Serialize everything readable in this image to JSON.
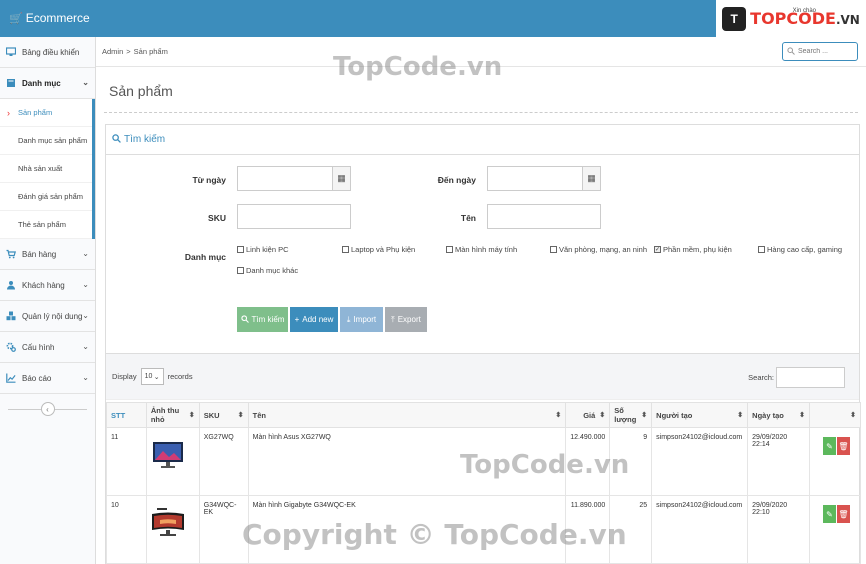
{
  "app": {
    "brand": "Ecommerce",
    "greeting": "Xin chào",
    "logo_text": "TOPCODE",
    "logo_suffix": ".VN",
    "logo_mark": "T"
  },
  "sidebar": {
    "items": [
      {
        "label": "Bảng điều khiển",
        "icon": "monitor-icon"
      },
      {
        "label": "Danh mục",
        "icon": "book-icon",
        "expanded": true
      }
    ],
    "subitems": [
      {
        "label": "Sản phẩm",
        "current": true
      },
      {
        "label": "Danh mục sản phẩm"
      },
      {
        "label": "Nhà sản xuất"
      },
      {
        "label": "Đánh giá sản phẩm"
      },
      {
        "label": "Thẻ sản phẩm"
      }
    ],
    "groups": [
      {
        "label": "Bán hàng",
        "icon": "cart-icon"
      },
      {
        "label": "Khách hàng",
        "icon": "user-icon"
      },
      {
        "label": "Quản lý nội dung",
        "icon": "cubes-icon"
      },
      {
        "label": "Cấu hình",
        "icon": "gears-icon"
      },
      {
        "label": "Báo cáo",
        "icon": "chart-icon"
      }
    ]
  },
  "breadcrumb": {
    "root": "Admin",
    "sep": ">",
    "current": "Sản phẩm"
  },
  "topsearch": {
    "placeholder": "Search ..."
  },
  "page": {
    "title": "Sản phẩm"
  },
  "filter": {
    "title": "Tìm kiếm",
    "from_label": "Từ ngày",
    "to_label": "Đến ngày",
    "sku_label": "SKU",
    "name_label": "Tên",
    "category_label": "Danh mục",
    "categories": [
      {
        "label": "Linh kiện PC",
        "checked": false
      },
      {
        "label": "Laptop và Phụ kiện",
        "checked": false
      },
      {
        "label": "Màn hình máy tính",
        "checked": false
      },
      {
        "label": "Văn phòng, mạng, an ninh",
        "checked": false
      },
      {
        "label": "Phần mềm, phụ kiện",
        "checked": true
      },
      {
        "label": "Hàng cao cấp, gaming",
        "checked": false
      },
      {
        "label": "Danh mục khác",
        "checked": false
      }
    ],
    "buttons": {
      "search": "Tìm kiếm",
      "add": "Add new",
      "import": "Import",
      "export": "Export"
    }
  },
  "list": {
    "display_label": "Display",
    "display_value": "10",
    "records_label": "records",
    "search_label": "Search:",
    "columns": [
      "STT",
      "Ảnh thu nhỏ",
      "SKU",
      "Tên",
      "Giá",
      "Số lượng",
      "Người tạo",
      "Ngày tạo",
      ""
    ],
    "rows": [
      {
        "stt": "11",
        "sku": "XG27WQ",
        "name": "Màn hình Asus XG27WQ",
        "price": "12.490.000",
        "qty": "9",
        "creator": "simpson24102@icloud.com",
        "date": "29/09/2020 22:14"
      },
      {
        "stt": "10",
        "sku": "G34WQC-EK",
        "name": "Màn hình Gigabyte G34WQC-EK",
        "price": "11.890.000",
        "qty": "25",
        "creator": "simpson24102@icloud.com",
        "date": "29/09/2020 22:10"
      }
    ]
  },
  "watermarks": [
    "TopCode.vn",
    "TopCode.vn",
    "Copyright © TopCode.vn"
  ]
}
